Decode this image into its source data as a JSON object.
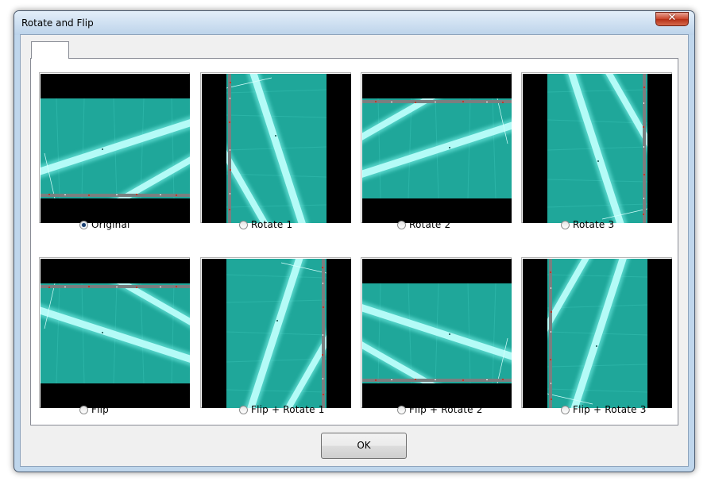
{
  "dialog": {
    "title": "Rotate and Flip",
    "close_icon": "close-icon"
  },
  "options": [
    {
      "label": "Original",
      "checked": true,
      "transform": "original"
    },
    {
      "label": "Rotate 1",
      "checked": false,
      "transform": "rotate-1"
    },
    {
      "label": "Rotate 2",
      "checked": false,
      "transform": "rotate-2"
    },
    {
      "label": "Rotate 3",
      "checked": false,
      "transform": "rotate-3"
    },
    {
      "label": "Flip",
      "checked": false,
      "transform": "flip"
    },
    {
      "label": "Flip + Rotate 1",
      "checked": false,
      "transform": "flip-rotate-1"
    },
    {
      "label": "Flip + Rotate 2",
      "checked": false,
      "transform": "flip-rotate-2"
    },
    {
      "label": "Flip + Rotate 3",
      "checked": false,
      "transform": "flip-rotate-3"
    }
  ],
  "buttons": {
    "ok_label": "OK"
  },
  "colors": {
    "image_background": "#1fa79a",
    "image_beam": "#9ef7f2",
    "letterbox": "#000000"
  }
}
